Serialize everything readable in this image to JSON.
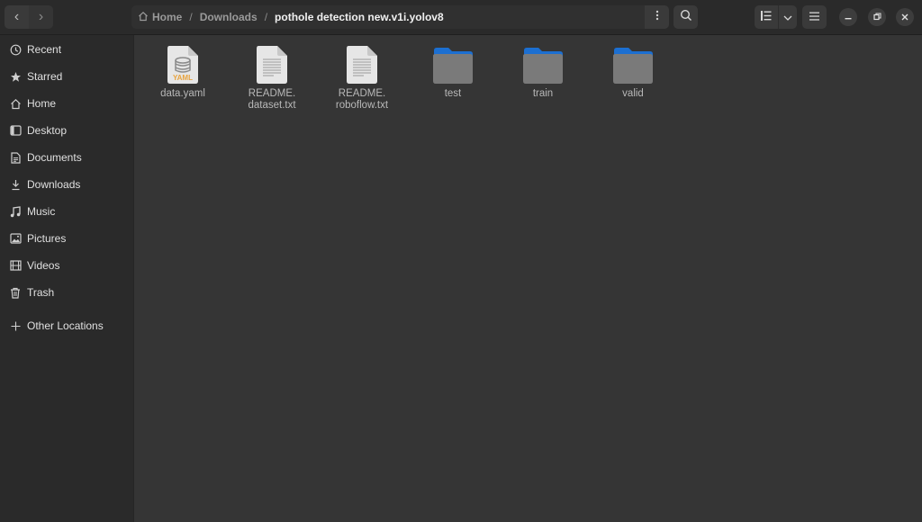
{
  "header": {
    "back_label": "‹",
    "forward_label": "›",
    "breadcrumb": [
      {
        "label": "Home",
        "icon": "home-icon"
      },
      {
        "label": "Downloads"
      },
      {
        "label": "pothole detection new.v1i.yolov8",
        "current": true
      }
    ],
    "separator": "/"
  },
  "sidebar": {
    "items": [
      {
        "label": "Recent",
        "icon": "clock-icon"
      },
      {
        "label": "Starred",
        "icon": "star-icon"
      },
      {
        "label": "Home",
        "icon": "home-icon"
      },
      {
        "label": "Desktop",
        "icon": "desktop-icon"
      },
      {
        "label": "Documents",
        "icon": "document-icon"
      },
      {
        "label": "Downloads",
        "icon": "download-icon"
      },
      {
        "label": "Music",
        "icon": "music-icon"
      },
      {
        "label": "Pictures",
        "icon": "picture-icon"
      },
      {
        "label": "Videos",
        "icon": "video-icon"
      },
      {
        "label": "Trash",
        "icon": "trash-icon"
      },
      {
        "label": "Other Locations",
        "icon": "plus-icon"
      }
    ]
  },
  "files": [
    {
      "name": "data.yaml",
      "type": "yaml",
      "badge": "YAML"
    },
    {
      "name": "README.\ndataset.txt",
      "type": "text"
    },
    {
      "name": "README.\nroboflow.txt",
      "type": "text"
    },
    {
      "name": "test",
      "type": "folder"
    },
    {
      "name": "train",
      "type": "folder"
    },
    {
      "name": "valid",
      "type": "folder"
    }
  ],
  "colors": {
    "folder_tab": "#1c6fd1",
    "folder_body": "#7a7a7a",
    "yaml_badge": "#e8a33d"
  }
}
